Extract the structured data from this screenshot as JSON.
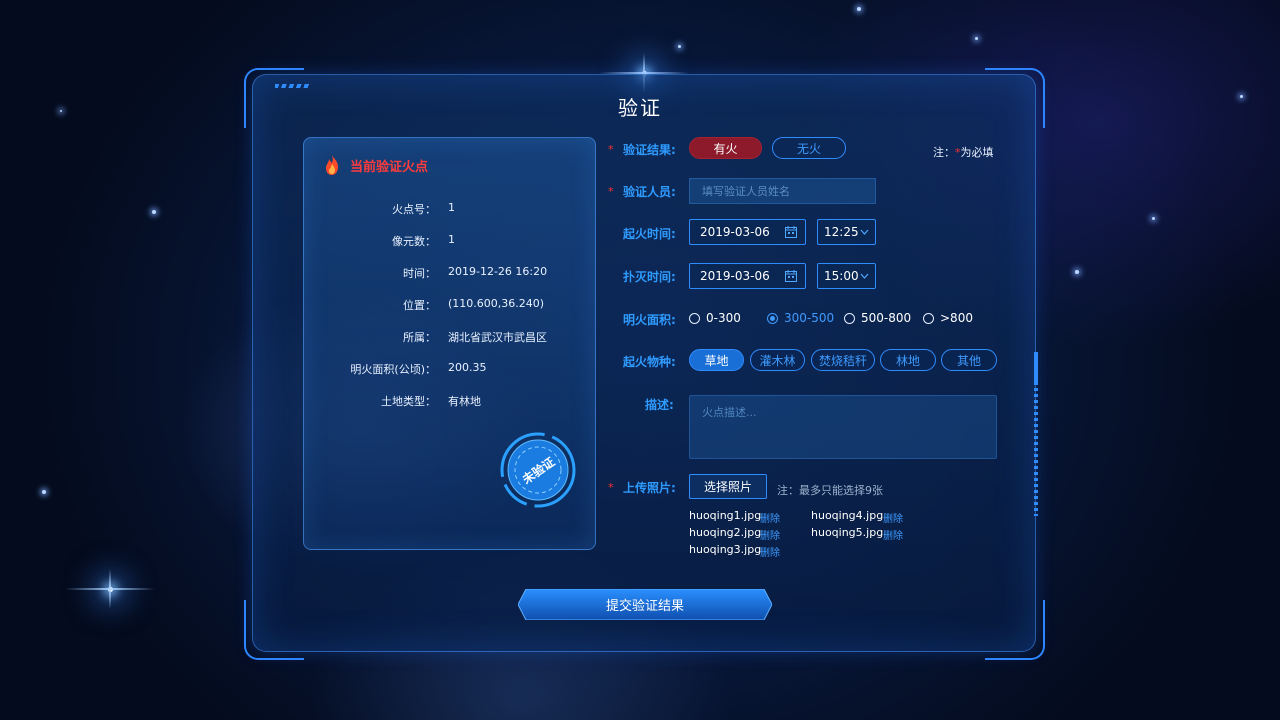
{
  "title": "验证",
  "card": {
    "title": "当前验证火点",
    "fields": [
      {
        "label": "火点号：",
        "value": "1"
      },
      {
        "label": "像元数：",
        "value": "1"
      },
      {
        "label": "时间：",
        "value": "2019-12-26 16:20"
      },
      {
        "label": "位置：",
        "value": "(110.600,36.240)"
      },
      {
        "label": "所属：",
        "value": "湖北省武汉市武昌区"
      },
      {
        "label": "明火面积(公顷)：",
        "value": "200.35"
      },
      {
        "label": "土地类型：",
        "value": "有林地"
      }
    ],
    "stamp": "未验证"
  },
  "form": {
    "note_prefix": "注：",
    "note_star": "*",
    "note_suffix": "为必填",
    "result_label": "验证结果:",
    "result_options": [
      "有火",
      "无火"
    ],
    "result_selected": "有火",
    "person_label": "验证人员:",
    "person_placeholder": "填写验证人员姓名",
    "start_label": "起火时间:",
    "start_date": "2019-03-06",
    "start_time": "12:25",
    "end_label": "扑灭时间:",
    "end_date": "2019-03-06",
    "end_time": "15:00",
    "area_label": "明火面积:",
    "area_options": [
      "0-300",
      "300-500",
      "500-800",
      ">800"
    ],
    "area_selected": "300-500",
    "type_label": "起火物种:",
    "type_options": [
      "草地",
      "灌木林",
      "焚烧秸秆",
      "林地",
      "其他"
    ],
    "type_selected": "草地",
    "desc_label": "描述:",
    "desc_placeholder": "火点描述...",
    "upload_label": "上传照片:",
    "upload_button": "选择照片",
    "upload_note": "注：最多只能选择9张",
    "files": [
      "huoqing1.jpg",
      "huoqing2.jpg",
      "huoqing3.jpg",
      "huoqing4.jpg",
      "huoqing5.jpg"
    ],
    "delete_label": "删除"
  },
  "submit_label": "提交验证结果",
  "colors": {
    "accent": "#2f9bff",
    "danger": "#ff3b3b",
    "selected_fill": "#1a6fd6",
    "panel_border": "#2d86ff"
  }
}
